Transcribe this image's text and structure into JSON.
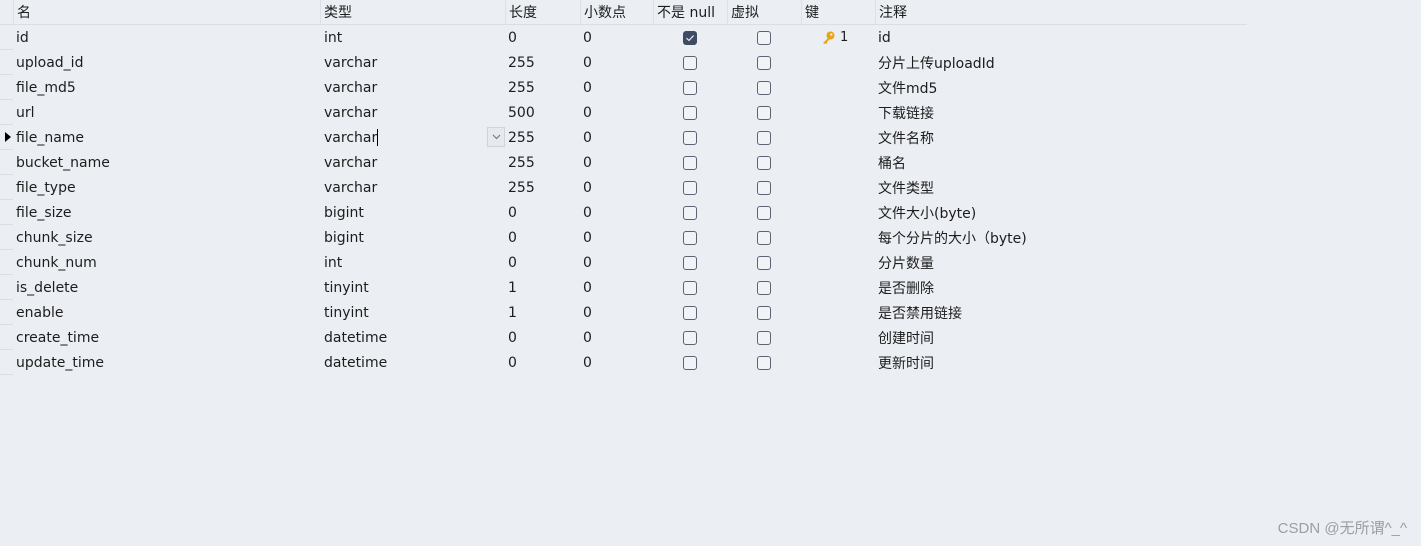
{
  "columns": {
    "name": "名",
    "type": "类型",
    "length": "长度",
    "decimal": "小数点",
    "not_null": "不是 null",
    "virtual": "虚拟",
    "key": "键",
    "comment": "注释"
  },
  "rows": [
    {
      "name": "id",
      "type": "int",
      "length": "0",
      "decimal": "0",
      "not_null": true,
      "virtual": false,
      "key": "1",
      "comment": "id"
    },
    {
      "name": "upload_id",
      "type": "varchar",
      "length": "255",
      "decimal": "0",
      "not_null": false,
      "virtual": false,
      "key": "",
      "comment": "分片上传uploadId"
    },
    {
      "name": "file_md5",
      "type": "varchar",
      "length": "255",
      "decimal": "0",
      "not_null": false,
      "virtual": false,
      "key": "",
      "comment": "文件md5"
    },
    {
      "name": "url",
      "type": "varchar",
      "length": "500",
      "decimal": "0",
      "not_null": false,
      "virtual": false,
      "key": "",
      "comment": "下载链接"
    },
    {
      "name": "file_name",
      "type": "varchar",
      "length": "255",
      "decimal": "0",
      "not_null": false,
      "virtual": false,
      "key": "",
      "comment": "文件名称",
      "selected": true
    },
    {
      "name": "bucket_name",
      "type": "varchar",
      "length": "255",
      "decimal": "0",
      "not_null": false,
      "virtual": false,
      "key": "",
      "comment": "桶名"
    },
    {
      "name": "file_type",
      "type": "varchar",
      "length": "255",
      "decimal": "0",
      "not_null": false,
      "virtual": false,
      "key": "",
      "comment": "文件类型"
    },
    {
      "name": "file_size",
      "type": "bigint",
      "length": "0",
      "decimal": "0",
      "not_null": false,
      "virtual": false,
      "key": "",
      "comment": "文件大小(byte)"
    },
    {
      "name": "chunk_size",
      "type": "bigint",
      "length": "0",
      "decimal": "0",
      "not_null": false,
      "virtual": false,
      "key": "",
      "comment": "每个分片的大小（byte)"
    },
    {
      "name": "chunk_num",
      "type": "int",
      "length": "0",
      "decimal": "0",
      "not_null": false,
      "virtual": false,
      "key": "",
      "comment": "分片数量"
    },
    {
      "name": "is_delete",
      "type": "tinyint",
      "length": "1",
      "decimal": "0",
      "not_null": false,
      "virtual": false,
      "key": "",
      "comment": "是否删除"
    },
    {
      "name": "enable",
      "type": "tinyint",
      "length": "1",
      "decimal": "0",
      "not_null": false,
      "virtual": false,
      "key": "",
      "comment": "是否禁用链接"
    },
    {
      "name": "create_time",
      "type": "datetime",
      "length": "0",
      "decimal": "0",
      "not_null": false,
      "virtual": false,
      "key": "",
      "comment": "创建时间"
    },
    {
      "name": "update_time",
      "type": "datetime",
      "length": "0",
      "decimal": "0",
      "not_null": false,
      "virtual": false,
      "key": "",
      "comment": "更新时间"
    }
  ],
  "icons": {
    "key": "key-icon",
    "row_pointer": "row-pointer-icon",
    "dropdown": "chevron-down-icon",
    "check": "check-icon"
  },
  "colors": {
    "background": "#ebeef3",
    "checkbox_checked": "#3e4c63",
    "key_icon": "#e8a317"
  },
  "watermark": "CSDN @无所谓^_^"
}
